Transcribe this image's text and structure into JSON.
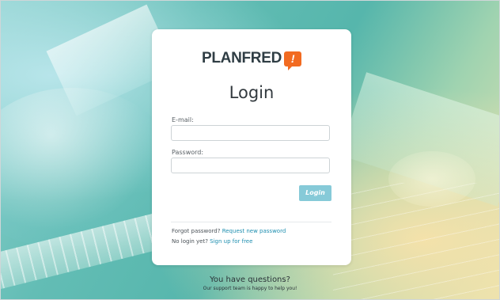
{
  "brand": {
    "logo_text": "PLANFRED",
    "logo_badge": "!",
    "badge_color": "#f26b21"
  },
  "login": {
    "title": "Login",
    "email_label": "E-mail:",
    "email_value": "",
    "password_label": "Password:",
    "password_value": "",
    "submit_label": "Login",
    "submit_color": "#86cad8"
  },
  "help": {
    "forgot_text": "Forgot password?",
    "forgot_link": "Request new password",
    "signup_text": "No login yet?",
    "signup_link": "Sign up for free",
    "link_color": "#1f8fb0"
  },
  "footer": {
    "question": "You have questions?",
    "support": "Our support team is happy to help you!"
  }
}
